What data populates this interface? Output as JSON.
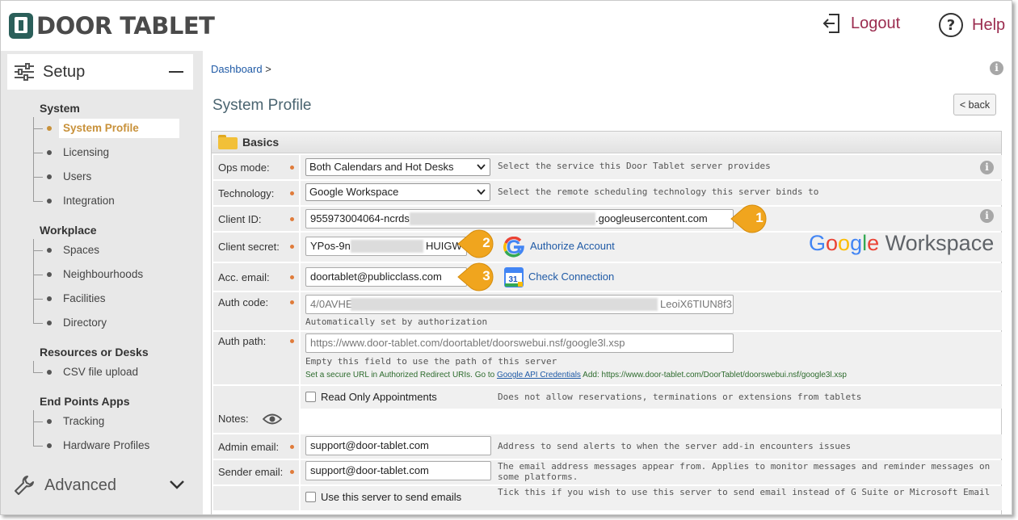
{
  "header": {
    "logo_text": "DOOR TABLET",
    "logout_label": "Logout",
    "help_label": "Help"
  },
  "sidebar": {
    "setup_label": "Setup",
    "advanced_label": "Advanced",
    "sections": [
      {
        "title": "System",
        "items": [
          "System Profile",
          "Licensing",
          "Users",
          "Integration"
        ]
      },
      {
        "title": "Workplace",
        "items": [
          "Spaces",
          "Neighbourhoods",
          "Facilities",
          "Directory"
        ]
      },
      {
        "title": "Resources or Desks",
        "items": [
          "CSV file upload"
        ]
      },
      {
        "title": "End Points Apps",
        "items": [
          "Tracking",
          "Hardware Profiles"
        ]
      }
    ],
    "active_item": "System Profile"
  },
  "main": {
    "breadcrumb_link": "Dashboard",
    "breadcrumb_sep": ">",
    "page_title": "System Profile",
    "back_label": "< back",
    "panel_title": "Basics",
    "fields": {
      "ops_mode": {
        "label": "Ops mode:",
        "value": "Both Calendars and Hot Desks",
        "hint": "Select the service this Door Tablet server provides"
      },
      "technology": {
        "label": "Technology:",
        "value": "Google Workspace",
        "hint": "Select the remote scheduling technology this server binds to"
      },
      "client_id": {
        "label": "Client ID:",
        "value_prefix": "955973004064-ncrds",
        "value_suffix": ".googleusercontent.com"
      },
      "client_secret": {
        "label": "Client secret:",
        "value_prefix": "YPos-9n",
        "value_suffix": "HUIGW",
        "action": "Authorize Account"
      },
      "acc_email": {
        "label": "Acc. email:",
        "value": "doortablet@publicclass.com",
        "action": "Check Connection"
      },
      "auth_code": {
        "label": "Auth code:",
        "value_prefix": "4/0AVHE",
        "value_suffix": "LeoiX6TIUN8f3",
        "hint": "Automatically set by authorization"
      },
      "auth_path": {
        "label": "Auth path:",
        "placeholder": "https://www.door-tablet.com/doortablet/doorswebui.nsf/google3l.xsp",
        "hint": "Empty this field to use the path of this server",
        "hint2_prefix": "Set a secure URL in Authorized Redirect URIs. Go to",
        "hint2_link": "Google API Credentials",
        "hint2_suffix": "Add: https://www.door-tablet.com/DoorTablet/doorswebui.nsf/google3l.xsp"
      },
      "read_only": {
        "label": "Read Only Appointments",
        "hint": "Does not allow reservations, terminations or extensions from tablets"
      },
      "notes": {
        "label": "Notes:"
      },
      "admin_email": {
        "label": "Admin email:",
        "value": "support@door-tablet.com",
        "hint": "Address to send alerts to when the server add-in encounters issues"
      },
      "sender_email": {
        "label": "Sender email:",
        "value": "support@door-tablet.com",
        "hint": "The email address messages appear from. Applies to monitor messages and reminder messages on some platforms."
      },
      "send_emails": {
        "label": "Use this server to send emails",
        "hint": "Tick this if you wish to use this server to send email instead of G Suite or Microsoft Email"
      }
    },
    "google_logo": {
      "g": "G",
      "o1": "o",
      "o2": "o",
      "g2": "g",
      "l": "l",
      "e": "e",
      "workspace": "Workspace"
    },
    "google_icon_letter": "G",
    "calendar_icon_number": "31",
    "callouts": [
      "1",
      "2",
      "3"
    ],
    "info_glyph": "i"
  },
  "colors": {
    "accent_active": "#c8913a",
    "link": "#1f5aa6",
    "header_link": "#9b2c4f",
    "callout": "#f0a51e",
    "required_dot": "#e07b3a"
  }
}
